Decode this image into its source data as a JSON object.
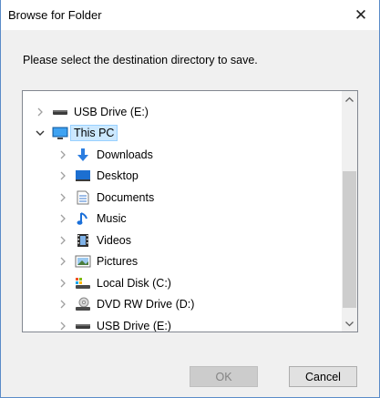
{
  "window": {
    "title": "Browse for Folder",
    "close_glyph": "✕"
  },
  "prompt": "Please select the destination directory to save.",
  "tree": {
    "items": [
      {
        "label": "USB Drive (E:)",
        "icon": "usb-drive-icon",
        "level": 0,
        "expanded": false
      },
      {
        "label": "This PC",
        "icon": "this-pc-icon",
        "level": 0,
        "expanded": true,
        "selected": true
      },
      {
        "label": "Downloads",
        "icon": "downloads-icon",
        "level": 1,
        "expanded": false
      },
      {
        "label": "Desktop",
        "icon": "desktop-icon",
        "level": 1,
        "expanded": false
      },
      {
        "label": "Documents",
        "icon": "documents-icon",
        "level": 1,
        "expanded": false
      },
      {
        "label": "Music",
        "icon": "music-icon",
        "level": 1,
        "expanded": false
      },
      {
        "label": "Videos",
        "icon": "videos-icon",
        "level": 1,
        "expanded": false
      },
      {
        "label": "Pictures",
        "icon": "pictures-icon",
        "level": 1,
        "expanded": false
      },
      {
        "label": "Local Disk (C:)",
        "icon": "local-disk-icon",
        "level": 1,
        "expanded": false
      },
      {
        "label": "DVD RW Drive (D:)",
        "icon": "dvd-drive-icon",
        "level": 1,
        "expanded": false
      },
      {
        "label": "USB Drive (E:)",
        "icon": "usb-drive-icon",
        "level": 1,
        "expanded": false
      }
    ]
  },
  "buttons": {
    "ok": "OK",
    "cancel": "Cancel"
  },
  "colors": {
    "selection_bg": "#cce8ff",
    "selection_border": "#99d1ff",
    "window_border": "#5a8bc8",
    "accent_blue": "#1e7ad6"
  }
}
